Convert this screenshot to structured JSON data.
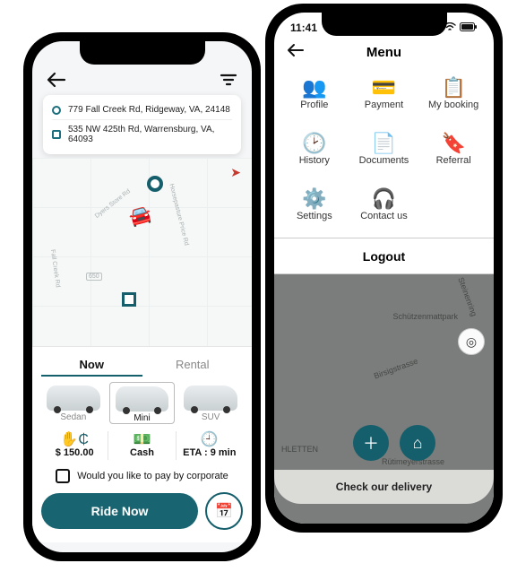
{
  "phone1": {
    "address_from": "779 Fall Creek Rd, Ridgeway, VA, 24148",
    "address_to": "535 NW 425th Rd, Warrensburg, VA, 64093",
    "map_roads": [
      "Dyers Store Rd",
      "Horsepasture Price Rd",
      "Fall Creek Rd",
      "650"
    ],
    "tabs": {
      "now": "Now",
      "rental": "Rental"
    },
    "cars": {
      "sedan": "Sedan",
      "mini": "Mini",
      "suv": "SUV"
    },
    "price_label": "$ 150.00",
    "pay_label": "Cash",
    "eta_label": "ETA : 9 min",
    "corporate_q": "Would you like to pay by corporate",
    "cta": "Ride Now"
  },
  "phone2": {
    "time": "11:41",
    "title": "Menu",
    "items": {
      "profile": "Profile",
      "payment": "Payment",
      "booking": "My booking",
      "history": "History",
      "documents": "Documents",
      "referral": "Referral",
      "settings": "Settings",
      "contact": "Contact us"
    },
    "logout": "Logout",
    "map_labels": [
      "Schützenmattpark",
      "HLETTEN",
      "Steinenring",
      "Birsigstrasse",
      "Rütimeyerstrasse"
    ],
    "delivery": "Check our delivery"
  },
  "colors": {
    "brand": "#155e6b"
  }
}
